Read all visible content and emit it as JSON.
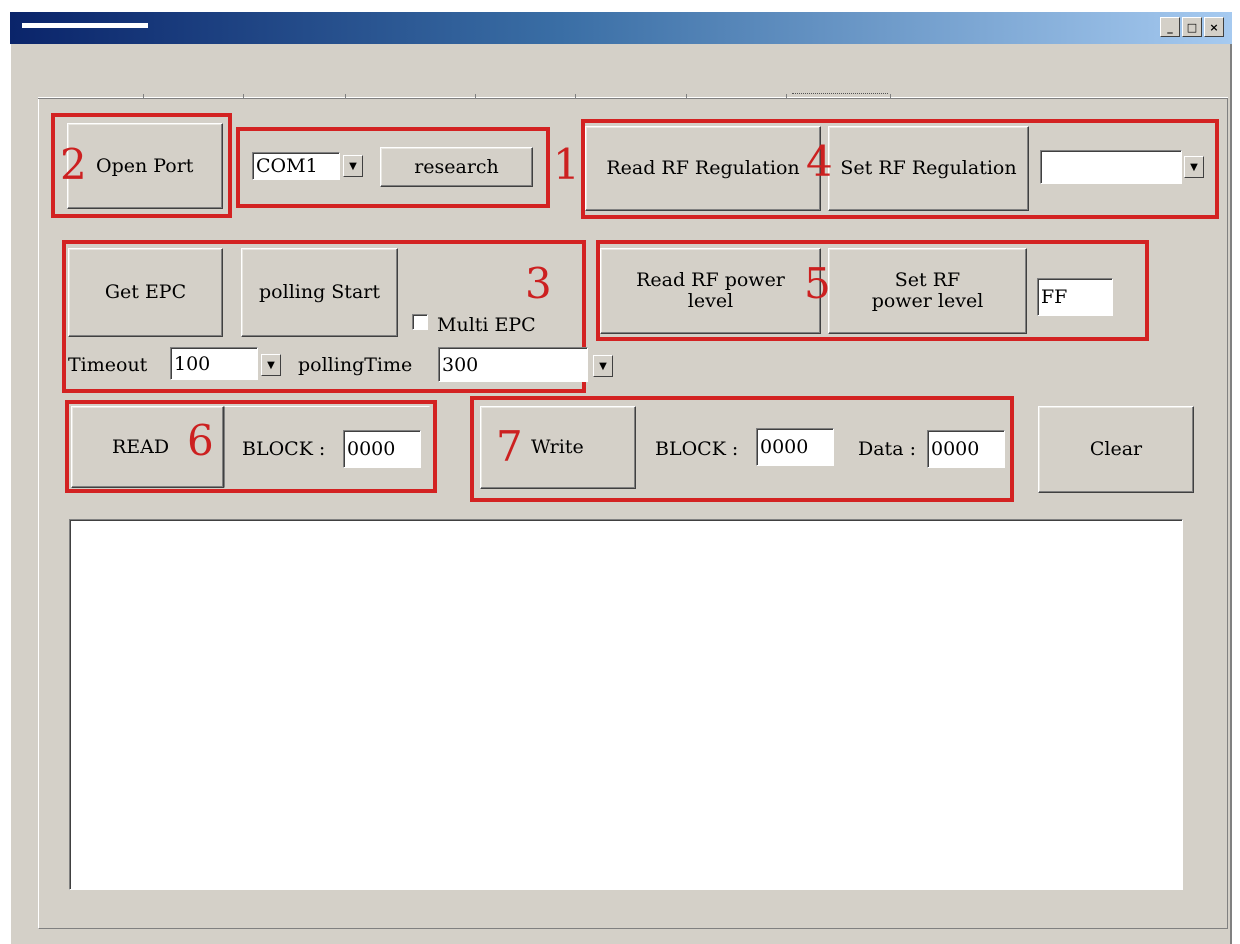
{
  "window": {
    "controls": {
      "minimize": "_",
      "maximize": "□",
      "close": "×"
    }
  },
  "annotations": [
    "1",
    "2",
    "3",
    "4",
    "5",
    "6",
    "7"
  ],
  "port": {
    "open_port_label": "Open Port",
    "com_value": "COM1",
    "research_label": "research"
  },
  "rf_regulation": {
    "read_label": "Read RF Regulation",
    "set_label": "Set RF Regulation",
    "select_value": ""
  },
  "epc": {
    "get_epc_label": "Get EPC",
    "polling_start_label": "polling Start",
    "multi_epc_label": "Multi EPC",
    "multi_epc_checked": false,
    "timeout_label": "Timeout",
    "timeout_value": "100",
    "polling_time_label": "pollingTime",
    "polling_time_value": "300"
  },
  "rf_power": {
    "read_label": "Read RF power level",
    "set_label": "Set RF power level",
    "value": "FF"
  },
  "read": {
    "read_label": "READ",
    "block_label": "BLOCK :",
    "block_value": "0000"
  },
  "write": {
    "write_label": "Write",
    "block_label": "BLOCK :",
    "block_value": "0000",
    "data_label": "Data :",
    "data_value": "0000"
  },
  "clear_label": "Clear",
  "output_text": ""
}
